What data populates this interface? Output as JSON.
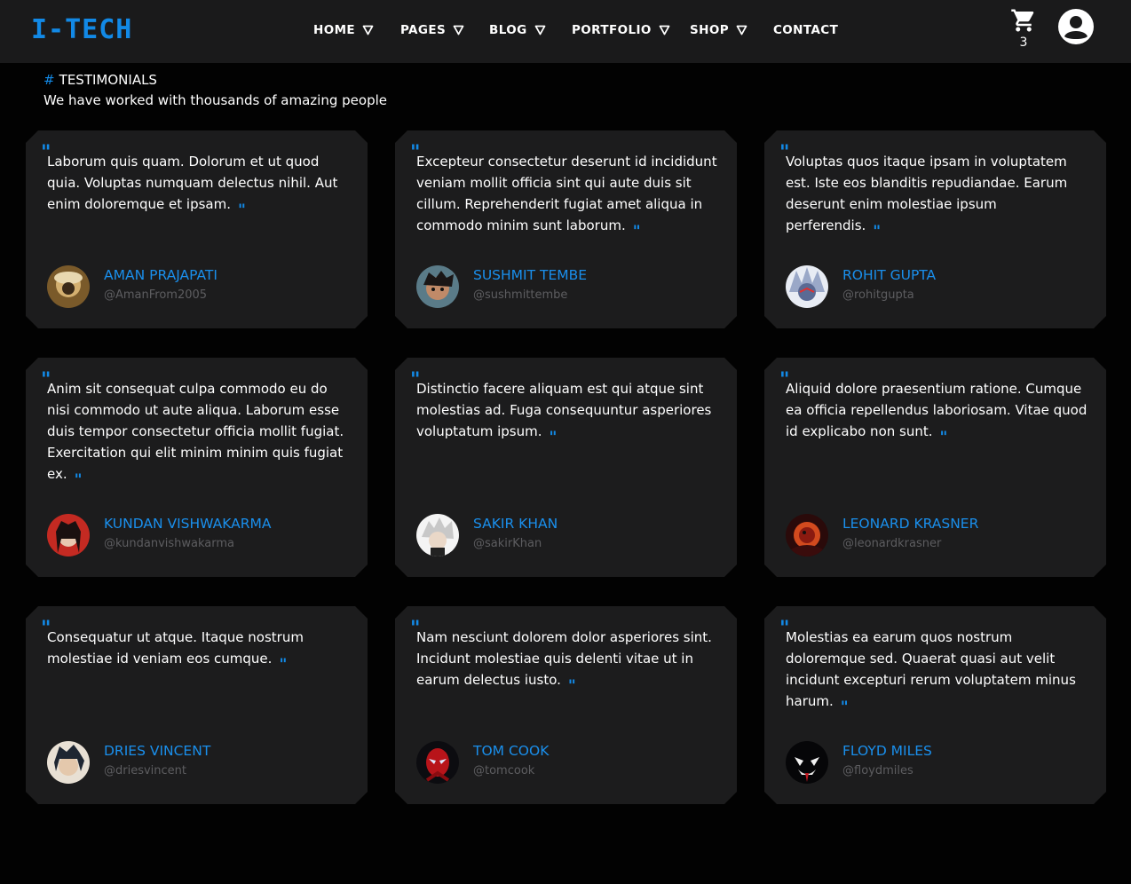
{
  "brand": {
    "logo": "I-TECH",
    "accent": "#1289e6"
  },
  "nav": {
    "items": [
      {
        "label": "HOME",
        "dropdown": true
      },
      {
        "label": "PAGES",
        "dropdown": true
      },
      {
        "label": "BLOG",
        "dropdown": true
      },
      {
        "label": "PORTFOLIO",
        "dropdown": true
      },
      {
        "label": "SHOP",
        "dropdown": true
      },
      {
        "label": "CONTACT",
        "dropdown": false
      }
    ],
    "cart_icon": "shopping-cart-icon",
    "cart_count": "3",
    "account_icon": "user-circle-icon"
  },
  "section": {
    "hash": "#",
    "tag": "TESTIMONIALS",
    "subtitle": "We have worked with thousands of amazing people"
  },
  "testimonials": [
    {
      "quote": "Laborum quis quam. Dolorum et ut quod quia. Voluptas numquam delectus nihil. Aut enim doloremque et ipsam.",
      "name": "AMAN PRAJAPATI",
      "handle": "@AmanFrom2005",
      "avatar": "avatar-amanprajapati"
    },
    {
      "quote": "Excepteur consectetur deserunt id incididunt veniam mollit officia sint qui aute duis sit cillum. Reprehenderit fugiat amet aliqua in commodo minim sunt laborum.",
      "name": "SUSHMIT TEMBE",
      "handle": "@sushmittembe",
      "avatar": "avatar-sushmittembe"
    },
    {
      "quote": "Voluptas quos itaque ipsam in voluptatem est. Iste eos blanditis repudiandae. Earum deserunt enim molestiae ipsum perferendis.",
      "name": "ROHIT GUPTA",
      "handle": "@rohitgupta",
      "avatar": "avatar-rohitgupta"
    },
    {
      "quote": "Anim sit consequat culpa commodo eu do nisi commodo ut aute aliqua. Laborum esse duis tempor consectetur officia mollit fugiat. Exercitation qui elit minim minim quis fugiat ex.",
      "name": "KUNDAN VISHWAKARMA",
      "handle": "@kundanvishwakarma",
      "avatar": "avatar-kundanvishwakarma"
    },
    {
      "quote": "Distinctio facere aliquam est qui atque sint molestias ad. Fuga consequuntur asperiores voluptatum ipsum.",
      "name": "SAKIR KHAN",
      "handle": "@sakirKhan",
      "avatar": "avatar-sakirkhan"
    },
    {
      "quote": "Aliquid dolore praesentium ratione. Cumque ea officia repellendus laboriosam. Vitae quod id explicabo non sunt.",
      "name": "LEONARD KRASNER",
      "handle": "@leonardkrasner",
      "avatar": "avatar-leonardkrasner"
    },
    {
      "quote": "Consequatur ut atque. Itaque nostrum molestiae id veniam eos cumque.",
      "name": "DRIES VINCENT",
      "handle": "@driesvincent",
      "avatar": "avatar-driesvincent"
    },
    {
      "quote": "Nam nesciunt dolorem dolor asperiores sint. Incidunt molestiae quis delenti vitae ut in earum delectus iusto.",
      "name": "TOM COOK",
      "handle": "@tomcook",
      "avatar": "avatar-tomcook"
    },
    {
      "quote": "Molestias ea earum quos nostrum doloremque sed. Quaerat quasi aut velit incidunt excepturi rerum voluptatem minus harum.",
      "name": "FLOYD MILES",
      "handle": "@floydmiles",
      "avatar": "avatar-floydmiles"
    }
  ]
}
